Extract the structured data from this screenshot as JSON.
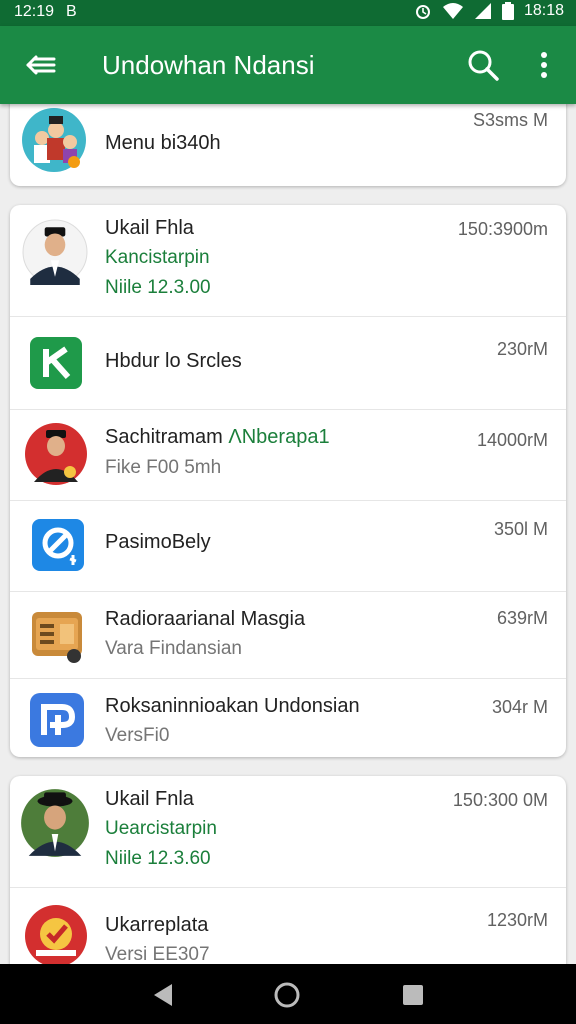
{
  "status_bar": {
    "time": "12:19",
    "notification": "B",
    "battery_time": "18:18"
  },
  "app_bar": {
    "title": "Undowhan Ndansi"
  },
  "colors": {
    "primary": "#1b8a45",
    "primary_dark": "#0f6b33",
    "accent_text": "#1b7f3b"
  },
  "cards": [
    {
      "items": [
        {
          "name": "Menu bi340h",
          "time": "S3sms M"
        }
      ]
    },
    {
      "items": [
        {
          "name": "Ukail Fhla",
          "line2": "Kancistarpin",
          "line3": "Niile 12.3.00",
          "time": "150:3900m"
        },
        {
          "name": "Hbdur lo Srcles",
          "time": "230rM"
        },
        {
          "name": "Sachitramam",
          "name_green": "ɅNberapa1",
          "line2": "Fike F00 5mh",
          "time": "14000rM"
        },
        {
          "name": "PasimoBely",
          "time": "350l M"
        },
        {
          "name": "Radioraarianal Masgia",
          "line2": "Vara Findansian",
          "time": "639rM"
        },
        {
          "name": "Roksaninnioakan Undonsian",
          "line2": "VersFi0",
          "time": "304r M"
        }
      ]
    },
    {
      "items": [
        {
          "name": "Ukail Fnla",
          "line2": "Uearcistarpin",
          "line3": "Niile 12.3.60",
          "time": "150:300 0M"
        },
        {
          "name": "Ukarreplata",
          "line2": "Versi EE307",
          "time": "1230rM"
        }
      ]
    }
  ]
}
